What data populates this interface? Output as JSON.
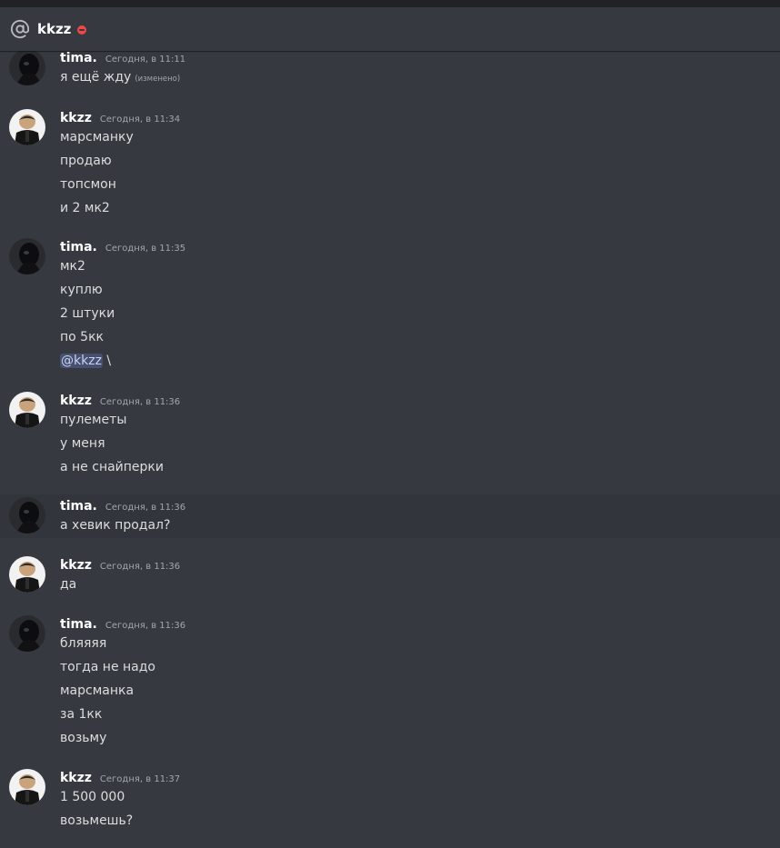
{
  "header": {
    "icon": "at-icon",
    "channel_name": "kkzz",
    "status": "dnd"
  },
  "messages": [
    {
      "author": "tima.",
      "time": "Сегодня, в 11:11",
      "lines": [
        "я  ещё жду"
      ],
      "edited": "(изменено)"
    },
    {
      "author": "kkzz",
      "time": "Сегодня, в 11:34",
      "lines": [
        "марсманку",
        "продаю",
        "топсмон",
        "и 2 мк2"
      ]
    },
    {
      "author": "tima.",
      "time": "Сегодня, в 11:35",
      "lines": [
        "мк2",
        "куплю",
        "2 штуки",
        "по 5кк"
      ],
      "mention": "@kkzz",
      "mention_suffix": " \\"
    },
    {
      "author": "kkzz",
      "time": "Сегодня, в 11:36",
      "lines": [
        "пулеметы",
        "у меня",
        "а не снайперки"
      ]
    },
    {
      "author": "tima.",
      "time": "Сегодня, в 11:36",
      "lines": [
        "а хевик продал?"
      ]
    },
    {
      "author": "kkzz",
      "time": "Сегодня, в 11:36",
      "lines": [
        "да"
      ]
    },
    {
      "author": "tima.",
      "time": "Сегодня, в 11:36",
      "lines": [
        "бляяяя",
        "тогда не надо",
        "марсманка",
        "за 1кк",
        "возьму"
      ]
    },
    {
      "author": "kkzz",
      "time": "Сегодня, в 11:37",
      "lines": [
        "1 500 000",
        "возьмешь?"
      ]
    }
  ]
}
